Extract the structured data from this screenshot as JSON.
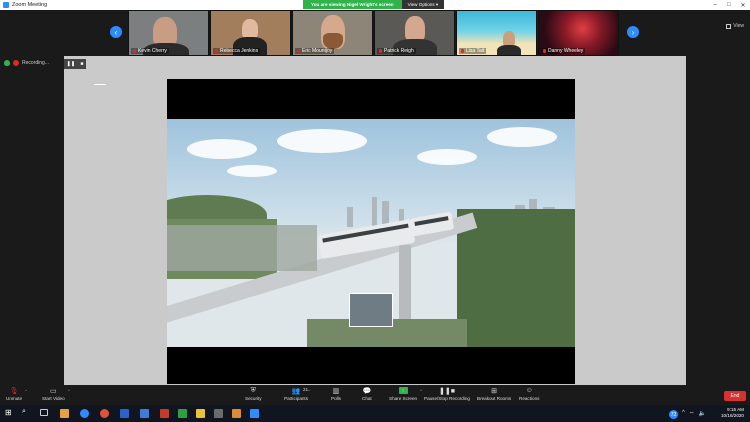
{
  "window": {
    "title": "Zoom Meeting",
    "controls": [
      "–",
      "□",
      "✕"
    ]
  },
  "banner": {
    "message": "You are viewing Nigel Wright's screen",
    "options_label": "View Options ▾"
  },
  "gallery": {
    "participants": [
      {
        "name": "Kevin Cherry",
        "bg": "#7b7f80",
        "face": "#c99d84",
        "hair": "#4a3a2d"
      },
      {
        "name": "Rebecca Jenkins",
        "bg": "#a27e5c",
        "face": "#e0b9a0",
        "hair": "#3b2a20"
      },
      {
        "name": "Eric Mountjoy",
        "bg": "#8d8578",
        "face": "#d7a98c",
        "hair": "#7a4e30"
      },
      {
        "name": "Patrick Reigh",
        "bg": "#5a5955",
        "face": "#d4a88f",
        "hair": "#3a3a3a"
      },
      {
        "name": "Lisa Tait",
        "bg": "#3eb8d8",
        "face": "#caa07d",
        "hair": "#3e3326"
      },
      {
        "name": "Danny Wheeley",
        "bg": "#5a1520",
        "face": "#cc3030",
        "hair": "#1a0a10"
      }
    ],
    "view_label": "View"
  },
  "recording": {
    "label": "Recording..."
  },
  "toolbar": {
    "unmute": "Unmute",
    "start_video": "Start Video",
    "security": "Security",
    "participants": "Participants",
    "participants_count": "21",
    "polls": "Polls",
    "chat": "Chat",
    "share_screen": "Share Screen",
    "pause_recording": "Pause/Stop Recording",
    "breakout": "Breakout Rooms",
    "reactions": "Reactions",
    "end": "End"
  },
  "taskbar": {
    "time": "9:15 AM",
    "date": "10/16/2020",
    "notification_count": "72",
    "app_colors": [
      "#e6a23c",
      "#2d8cff",
      "#e0533a",
      "#2b63c9",
      "#3c7bd6",
      "#c43b2a",
      "#2f9f45",
      "#e8c33a",
      "#6b6b6b",
      "#d98c3a",
      "#2d8cff"
    ]
  },
  "colors": {
    "accent": "#2d8cff",
    "share_green": "#2fb34a",
    "end_red": "#d93030"
  }
}
